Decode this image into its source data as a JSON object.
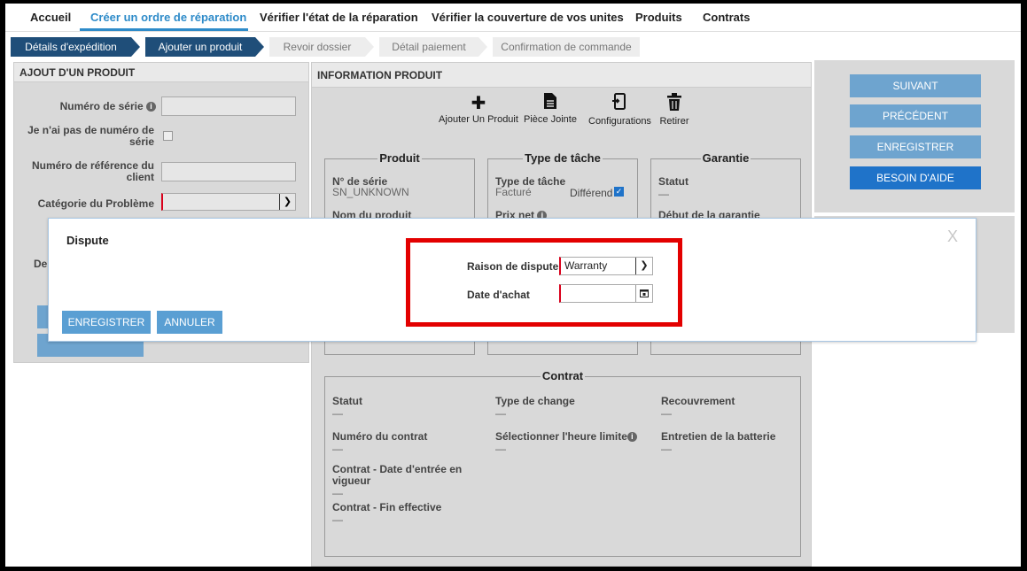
{
  "topnav": {
    "items": [
      {
        "label": "Accueil"
      },
      {
        "label": "Créer un ordre de réparation"
      },
      {
        "label": "Vérifier l'état de la réparation"
      },
      {
        "label": "Vérifier la couverture de vos unites"
      },
      {
        "label": "Produits"
      },
      {
        "label": "Contrats"
      }
    ],
    "active_index": 1
  },
  "steps": [
    {
      "label": "Détails d'expédition",
      "state": "done"
    },
    {
      "label": "Ajouter un produit",
      "state": "current"
    },
    {
      "label": "Revoir dossier",
      "state": "todo"
    },
    {
      "label": "Détail paiement",
      "state": "todo"
    },
    {
      "label": "Confirmation de commande",
      "state": "todo"
    }
  ],
  "left": {
    "title": "AJOUT D'UN PRODUIT",
    "serial_label": "Numéro de série",
    "no_serial_label": "Je n'ai pas de numéro de série",
    "client_ref_label": "Numéro de référence du client",
    "problem_category_label": "Catégorie du Problème",
    "partial_label": "De"
  },
  "center": {
    "title": "INFORMATION PRODUIT",
    "tools": [
      {
        "label": "Ajouter Un Produit",
        "icon": "plus-icon"
      },
      {
        "label": "Pièce Jointe",
        "icon": "document-icon"
      },
      {
        "label": "Configurations",
        "icon": "configurations-icon"
      },
      {
        "label": "Retirer",
        "icon": "trash-icon"
      }
    ],
    "produit": {
      "legend": "Produit",
      "serial_label": "N° de série",
      "serial_value": "SN_UNKNOWN",
      "name_label": "Nom du produit"
    },
    "type_tache": {
      "legend": "Type de tâche",
      "label": "Type de tâche",
      "value": "Facturé",
      "differend_label": "Différend",
      "differend_checked": true,
      "prix_label": "Prix net"
    },
    "garantie": {
      "legend": "Garantie",
      "statut_label": "Statut",
      "statut_value": "—",
      "debut_label": "Début de la garantie"
    },
    "contrat": {
      "legend": "Contrat",
      "statut_label": "Statut",
      "statut_value": "—",
      "type_change_label": "Type de change",
      "type_change_value": "—",
      "recouvrement_label": "Recouvrement",
      "recouvrement_value": "—",
      "numero_label": "Numéro du contrat",
      "numero_value": "—",
      "heure_label": "Sélectionner l'heure limite",
      "heure_value": "—",
      "batterie_label": "Entretien de la batterie",
      "batterie_value": "—",
      "date_entree_label": "Contrat - Date d'entrée en vigueur",
      "date_entree_value": "—",
      "fin_label": "Contrat - Fin effective",
      "fin_value": "—"
    }
  },
  "right": {
    "buttons": [
      {
        "label": "SUIVANT"
      },
      {
        "label": "PRÉCÉDENT"
      },
      {
        "label": "ENREGISTRER"
      },
      {
        "label": "BESOIN D'AIDE"
      }
    ]
  },
  "modal": {
    "title": "Dispute",
    "close": "X",
    "raison_label": "Raison de dispute",
    "raison_value": "Warranty",
    "date_label": "Date d'achat",
    "date_value": "",
    "save_label": "ENREGISTRER",
    "cancel_label": "ANNULER"
  },
  "colors": {
    "accent": "#2e8bc9",
    "step_dark": "#1f4e79",
    "button": "#6ea4cf",
    "primary_button": "#1f73c9",
    "highlight": "#e30000",
    "required": "#d9001b"
  }
}
